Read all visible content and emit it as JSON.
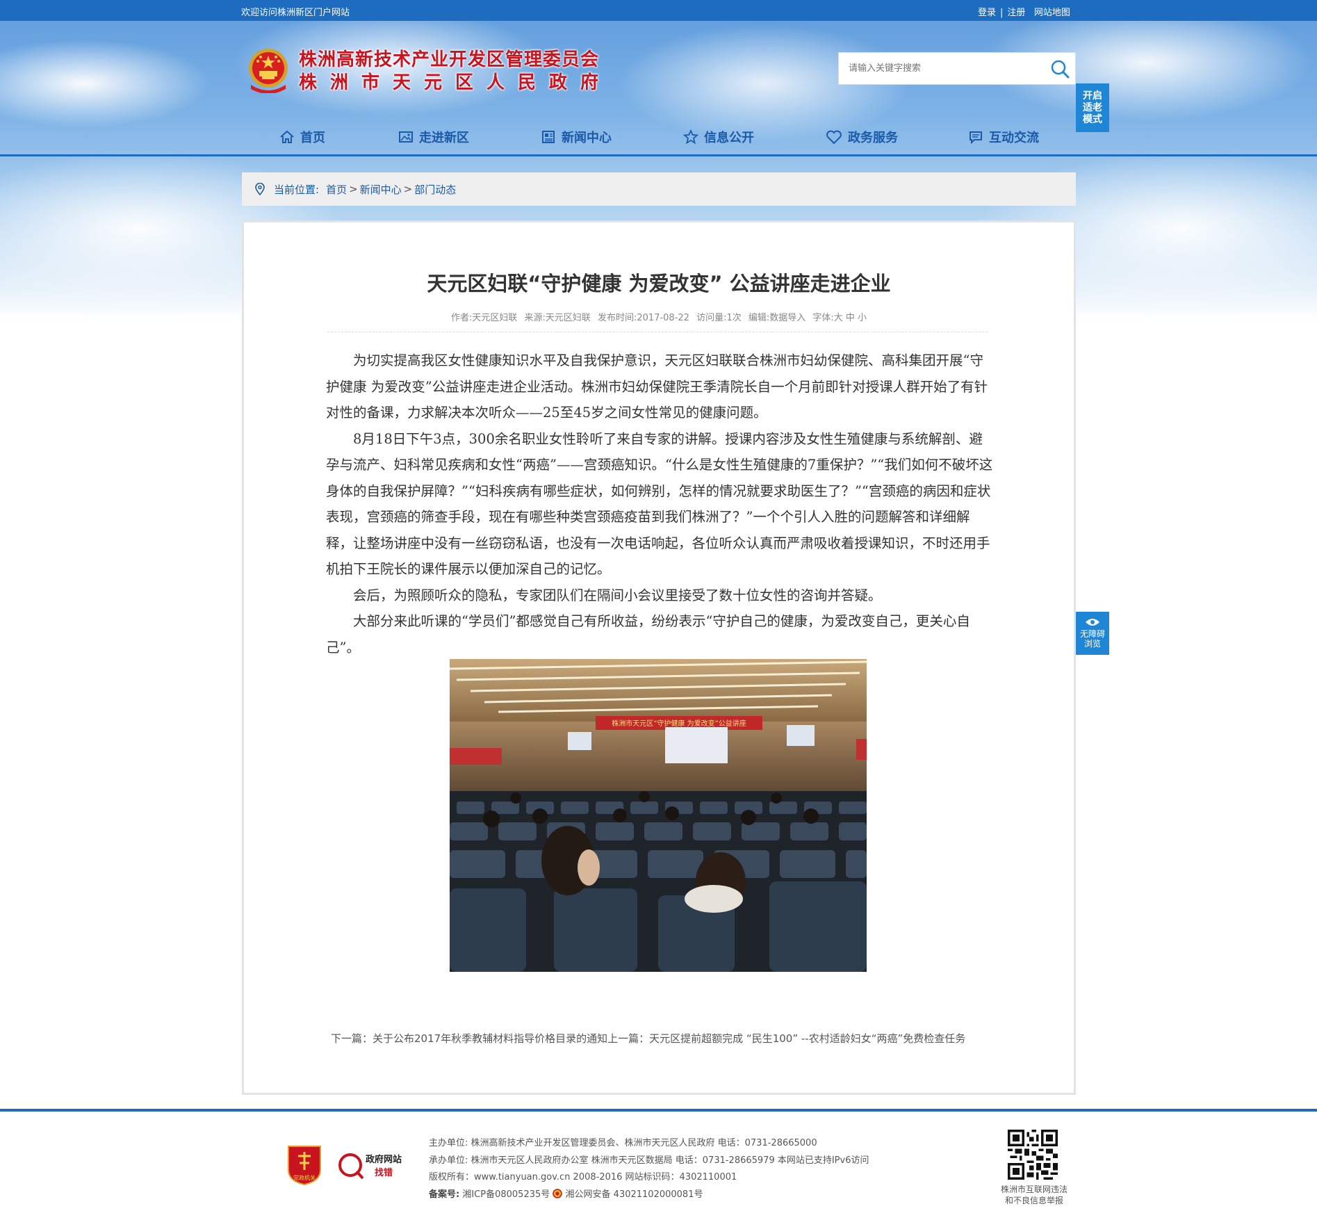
{
  "topbar": {
    "welcome": "欢迎访问株洲新区门户网站",
    "login": "登录",
    "separator": "|",
    "register": "注册",
    "sitemap": "网站地图"
  },
  "header": {
    "title_line1": "株洲高新技术产业开发区管理委员会",
    "title_line2": "株洲市天元区人民政府",
    "search_placeholder": "请输入关键字搜索",
    "elder_mode_line1": "开启",
    "elder_mode_line2": "适老",
    "elder_mode_line3": "模式"
  },
  "nav": {
    "items": [
      {
        "label": "首页",
        "icon": "home-icon"
      },
      {
        "label": "走进新区",
        "icon": "image-icon"
      },
      {
        "label": "新闻中心",
        "icon": "newspaper-icon"
      },
      {
        "label": "信息公开",
        "icon": "star-icon"
      },
      {
        "label": "政务服务",
        "icon": "heart-icon"
      },
      {
        "label": "互动交流",
        "icon": "chat-icon"
      }
    ]
  },
  "breadcrumb": {
    "label": "当前位置:",
    "items": [
      "首页",
      "新闻中心",
      "部门动态"
    ],
    "separator": ">"
  },
  "article": {
    "title": "天元区妇联“守护健康 为爱改变” 公益讲座走进企业",
    "meta": {
      "author": "作者:天元区妇联",
      "source": "来源:天元区妇联",
      "date": "发布时间:2017-08-22",
      "views": "访问量:1次",
      "editor": "编辑:数据导入",
      "font_size": "字体:大 中 小"
    },
    "paragraphs": [
      "为切实提高我区女性健康知识水平及自我保护意识，天元区妇联联合株洲市妇幼保健院、高科集团开展“守护健康 为爱改变”公益讲座走进企业活动。株洲市妇幼保健院王季清院长自一个月前即针对授课人群开始了有针对性的备课，力求解决本次听众——25至45岁之间女性常见的健康问题。",
      "8月18日下午3点，300余名职业女性聆听了来自专家的讲解。授课内容涉及女性生殖健康与系统解剖、避孕与流产、妇科常见疾病和女性“两癌”——宫颈癌知识。“什么是女性生殖健康的7重保护？”“我们如何不破坏这身体的自我保护屏障？”“妇科疾病有哪些症状，如何辨别，怎样的情况就要求助医生了？”“宫颈癌的病因和症状表现，宫颈癌的筛查手段，现在有哪些种类宫颈癌疫苗到我们株洲了？”一个个引人入胜的问题解答和详细解释，让整场讲座中没有一丝窃窃私语，也没有一次电话响起，各位听众认真而严肃吸收着授课知识，不时还用手机拍下王院长的课件展示以便加深自己的记忆。",
      "会后，为照顾听众的隐私，专家团队们在隔间小会议里接受了数十位女性的咨询并答疑。",
      "大部分来此听课的“学员们”都感觉自己有所收益，纷纷表示“守护自己的健康，为爱改变自己，更关心自己”。"
    ],
    "photo_banner": "株洲市天元区“守护健康 为爱改变”公益讲座",
    "prev_next": "下一篇：关于公布2017年秋季教辅材料指导价格目录的通知上一篇：天元区提前超额完成 “民生100” --农村适龄妇女“两癌”免费检查任务"
  },
  "accessibility": {
    "line1": "无障碍",
    "line2": "浏览"
  },
  "footer": {
    "host": "主办单位: 株洲高新技术产业开发区管理委员会、株洲市天元区人民政府 电话：0731-28665000",
    "operator": "承办单位: 株洲市天元区人民政府办公室 株洲市天元区数据局 电话：0731-28665979 本网站已支持IPv6访问",
    "copyright": "版权所有：www.tianyuan.gov.cn 2008-2016 网站标识码：4302110001",
    "record_label": "备案号:",
    "icp": "湘ICP备08005235号",
    "police": "湘公网安备 43021102000081号",
    "gov_error_line1": "政府网站",
    "gov_error_line2": "找错",
    "party_logo_text": "党政机关",
    "qr_caption_line1": "株洲市互联网违法",
    "qr_caption_line2": "和不良信息举报"
  },
  "colors": {
    "primary_blue": "#1e6cc0",
    "nav_text": "#1a5aa8",
    "title_red": "#c8141e",
    "side_button": "#1f86d6"
  }
}
